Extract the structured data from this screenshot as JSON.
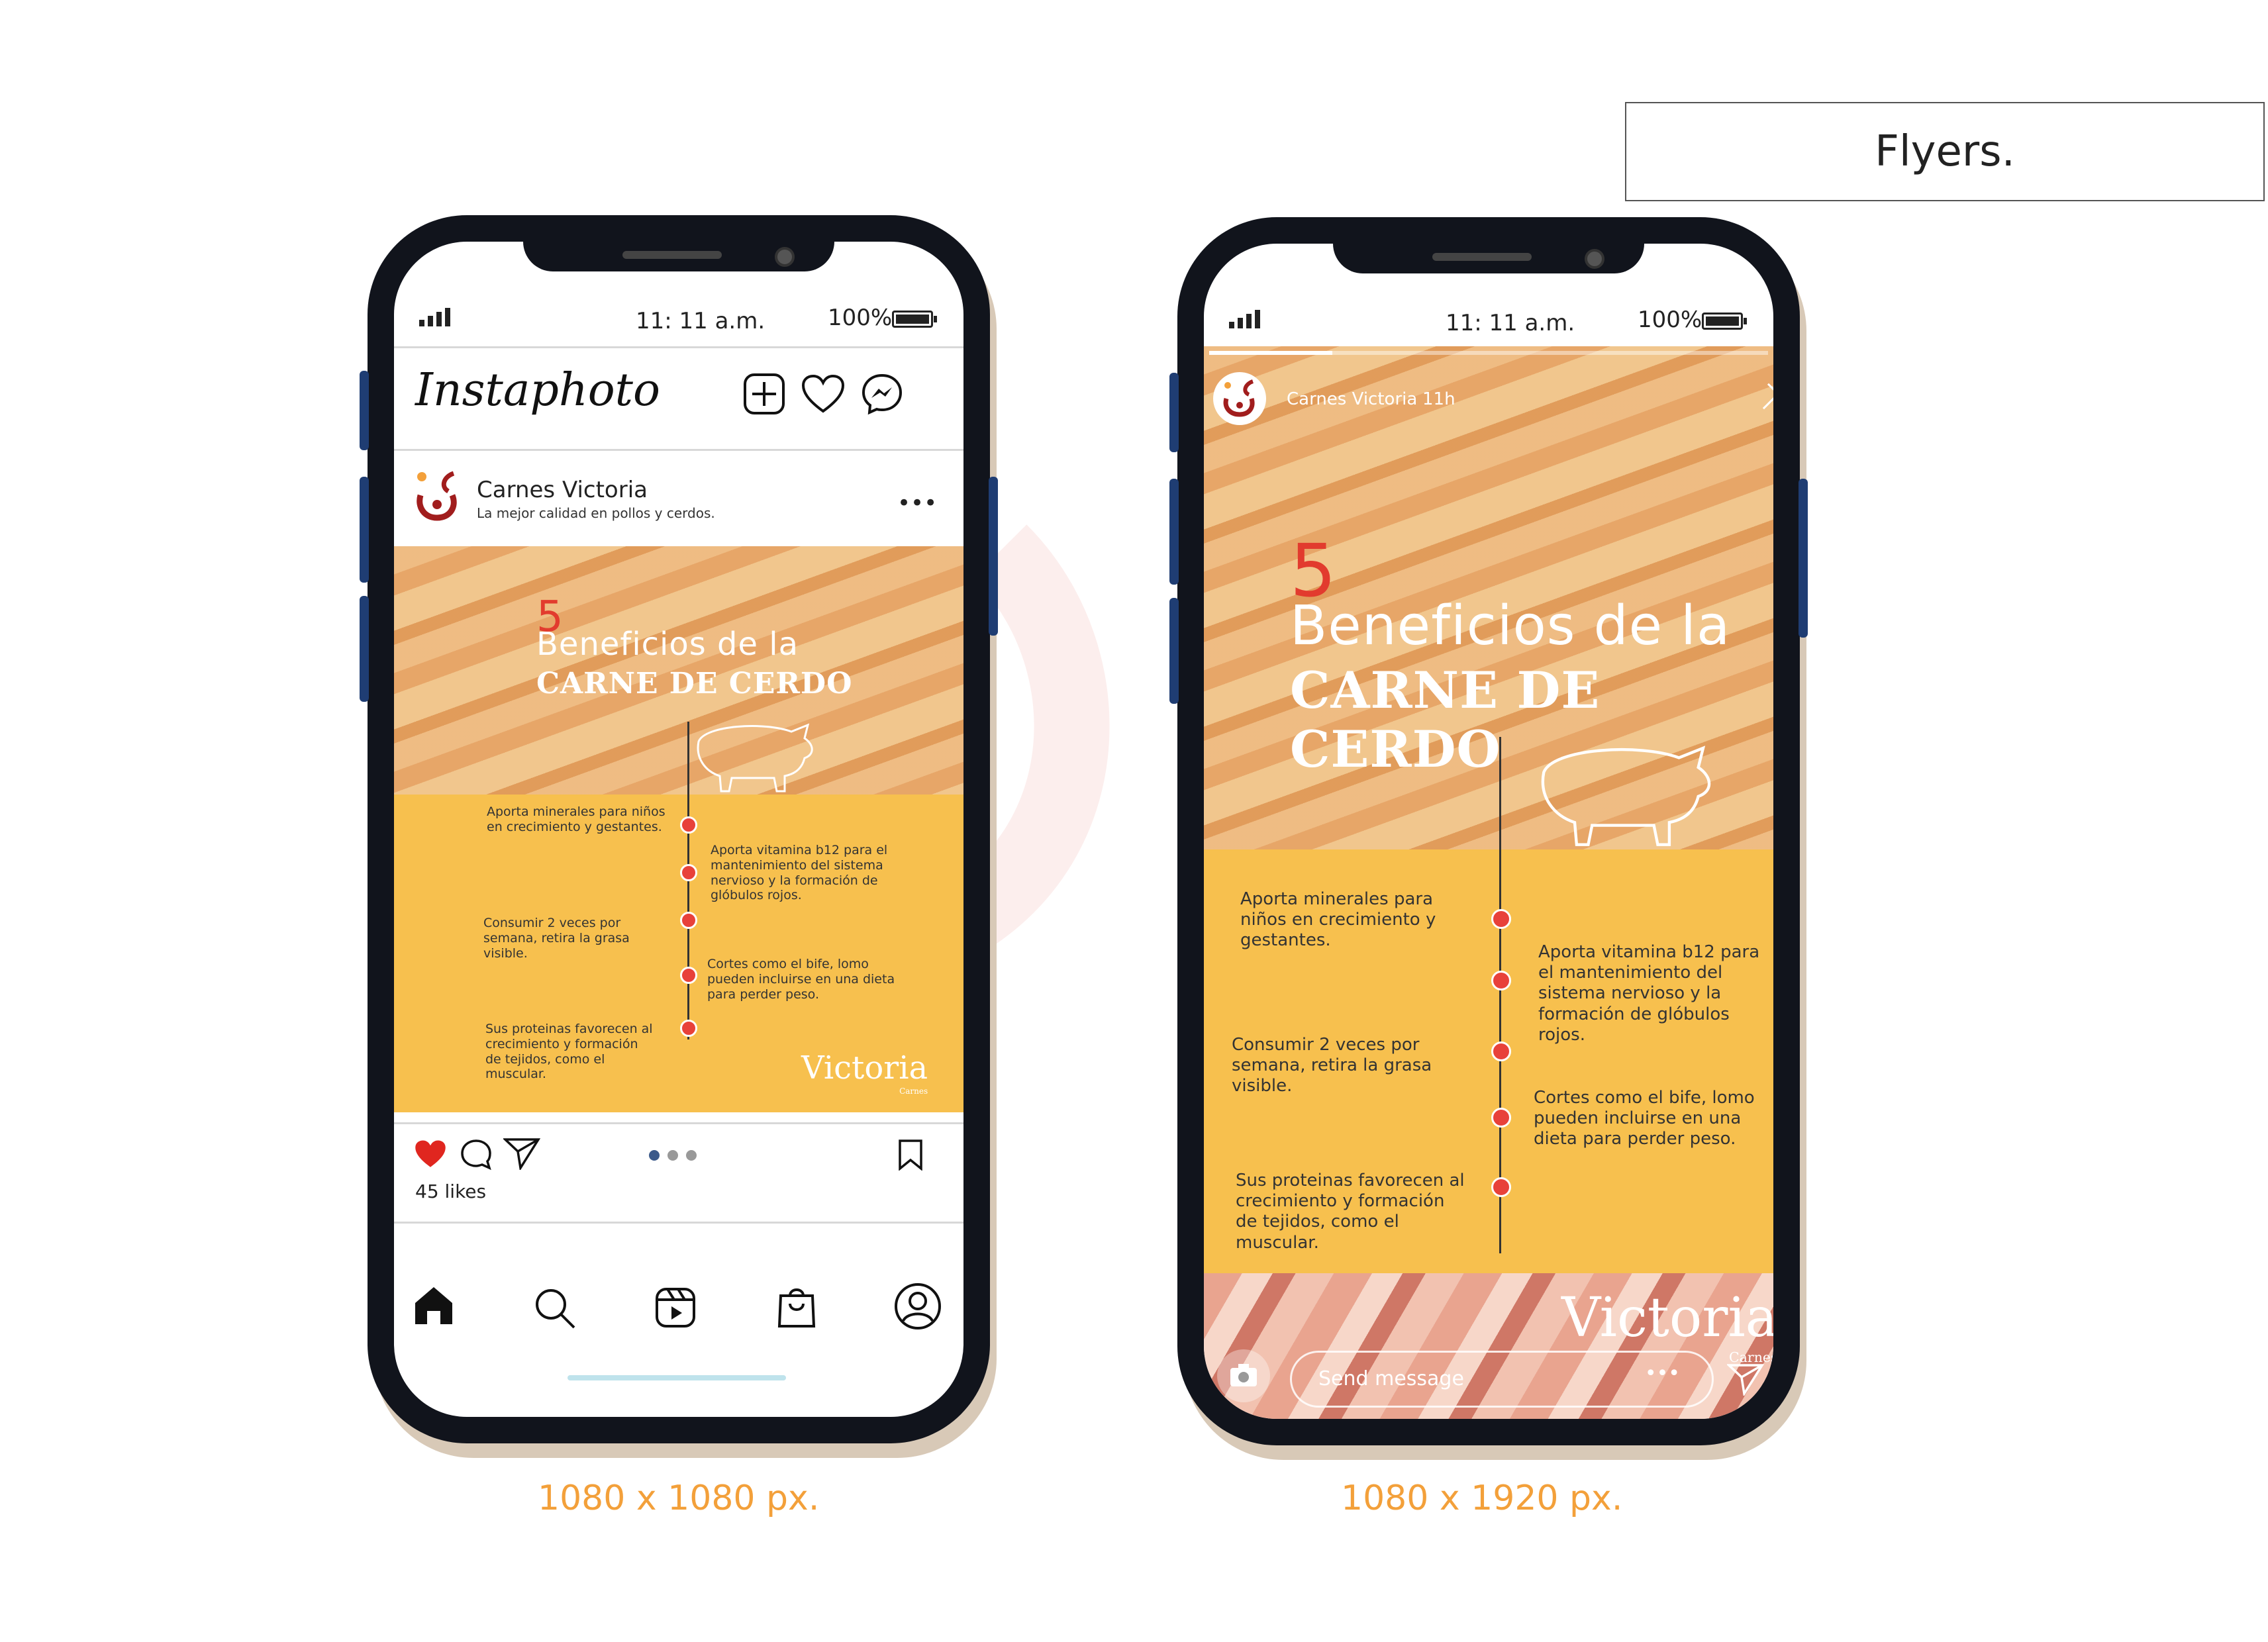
{
  "page_title": "Flyers.",
  "captions": {
    "left": "1080 x 1080 px.",
    "right": "1080 x 1920 px."
  },
  "status_bar": {
    "time": "11: 11 a.m.",
    "battery": "100%"
  },
  "instagram": {
    "brand": "Instaphoto",
    "account_name": "Carnes Victoria",
    "account_subtitle": "La mejor calidad en pollos y cerdos.",
    "more": "•••",
    "likes": "45 likes",
    "nav": [
      "home-icon",
      "search-icon",
      "reels-icon",
      "shop-icon",
      "profile-icon"
    ]
  },
  "story": {
    "account_name": "Carnes Victoria",
    "time_ago": "11h",
    "message_placeholder": "Send message",
    "more": "•••"
  },
  "flyer": {
    "number": "5",
    "heading": "Beneficios de la",
    "subheading": "CARNE DE CERDO",
    "benefits_left": [
      "Aporta minerales para niños en crecimiento y gestantes.",
      "Consumir 2 veces por semana, retira la grasa visible.",
      "Sus proteinas favorecen al crecimiento y formación de tejidos, como el muscular."
    ],
    "benefits_right": [
      "Aporta  vitamina b12 para el mantenimiento del sistema nervioso y la formación de glóbulos rojos.",
      "Cortes como el bife, lomo pueden incluirse en una dieta para perder peso."
    ],
    "brand": "Victoria",
    "brand_sub": "Carnes"
  },
  "colors": {
    "accent": "#f3a03a",
    "flyer_yellow": "#f7c04e",
    "red_dot": "#e8413a",
    "phone_frame": "#11141c",
    "side_button": "#1f3d73"
  }
}
